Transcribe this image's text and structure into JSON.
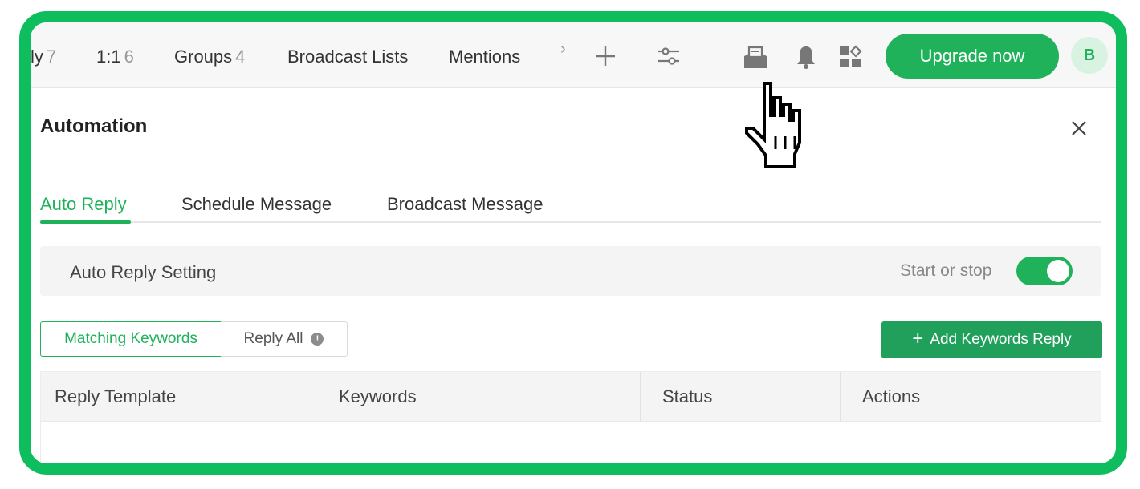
{
  "nav": {
    "items": [
      {
        "label": "ly",
        "count": "7"
      },
      {
        "label": "1:1",
        "count": "6"
      },
      {
        "label": "Groups",
        "count": "4"
      },
      {
        "label": "Broadcast Lists",
        "count": ""
      },
      {
        "label": "Mentions",
        "count": ""
      }
    ],
    "more_arrow": "›",
    "upgrade_label": "Upgrade now",
    "avatar_initial": "B"
  },
  "panel": {
    "title": "Automation",
    "tabs": [
      {
        "label": "Auto Reply",
        "active": true
      },
      {
        "label": "Schedule Message",
        "active": false
      },
      {
        "label": "Broadcast Message",
        "active": false
      }
    ]
  },
  "setting": {
    "label": "Auto Reply Setting",
    "toggle_label": "Start or stop",
    "toggle_on": true
  },
  "mode": {
    "matching_label": "Matching Keywords",
    "reply_all_label": "Reply All",
    "info_glyph": "!"
  },
  "add_button": {
    "label": "Add Keywords Reply",
    "plus": "+"
  },
  "table": {
    "columns": [
      "Reply Template",
      "Keywords",
      "Status",
      "Actions"
    ]
  },
  "colors": {
    "frame": "#0dbd5e",
    "accent": "#20b25b",
    "button_dark": "#20a05a"
  }
}
